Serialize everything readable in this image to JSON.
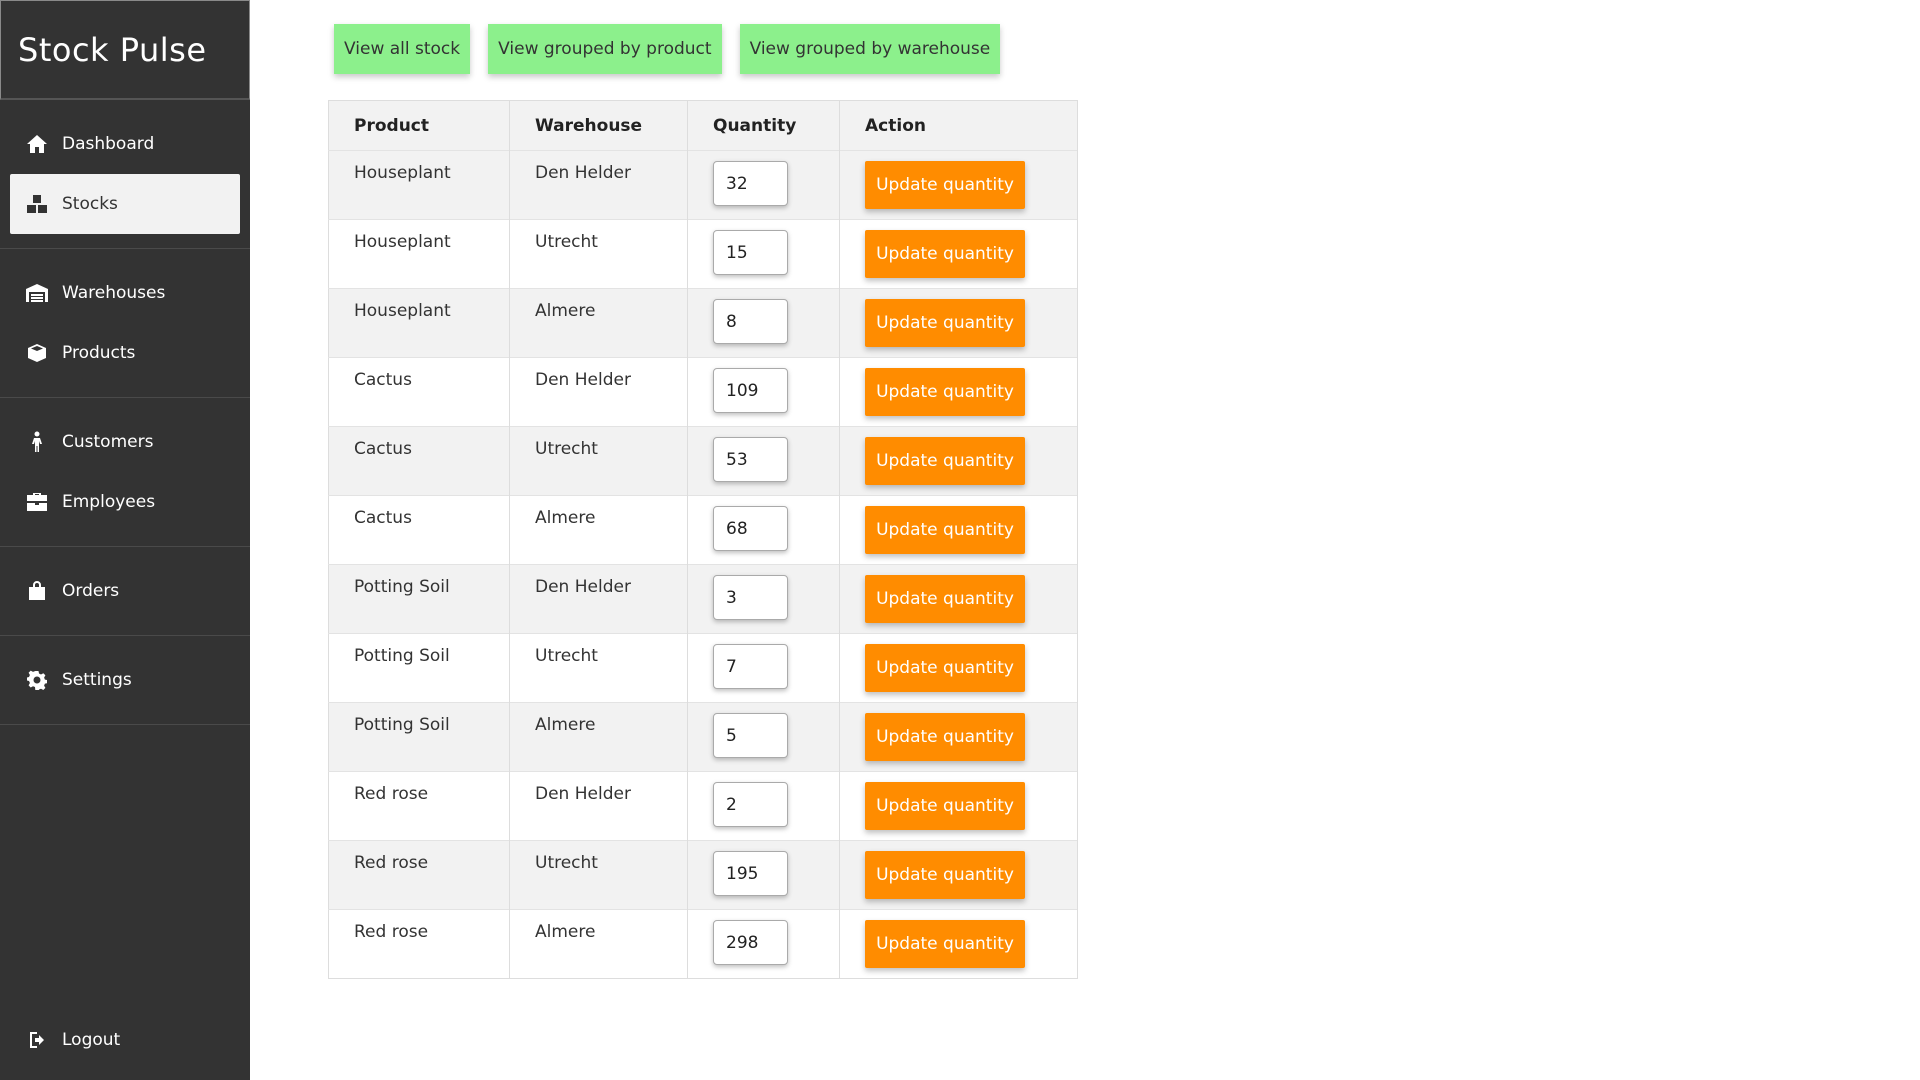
{
  "app": {
    "brand": "Stock Pulse"
  },
  "sidebar": {
    "groups": [
      [
        {
          "label": "Dashboard",
          "icon": "home-icon"
        },
        {
          "label": "Stocks",
          "icon": "boxes-icon",
          "active": true
        }
      ],
      [
        {
          "label": "Warehouses",
          "icon": "warehouse-icon"
        },
        {
          "label": "Products",
          "icon": "box-icon"
        }
      ],
      [
        {
          "label": "Customers",
          "icon": "person-icon"
        },
        {
          "label": "Employees",
          "icon": "briefcase-icon"
        }
      ],
      [
        {
          "label": "Orders",
          "icon": "bag-icon"
        }
      ],
      [
        {
          "label": "Settings",
          "icon": "gear-icon"
        }
      ]
    ],
    "logout": {
      "label": "Logout",
      "icon": "logout-icon"
    }
  },
  "view_buttons": [
    "View all stock",
    "View grouped by product",
    "View grouped by warehouse"
  ],
  "table": {
    "headers": [
      "Product",
      "Warehouse",
      "Quantity",
      "Action"
    ],
    "action_label": "Update quantity",
    "rows": [
      {
        "product": "Houseplant",
        "warehouse": "Den Helder",
        "quantity": "32"
      },
      {
        "product": "Houseplant",
        "warehouse": "Utrecht",
        "quantity": "15"
      },
      {
        "product": "Houseplant",
        "warehouse": "Almere",
        "quantity": "8"
      },
      {
        "product": "Cactus",
        "warehouse": "Den Helder",
        "quantity": "109"
      },
      {
        "product": "Cactus",
        "warehouse": "Utrecht",
        "quantity": "53"
      },
      {
        "product": "Cactus",
        "warehouse": "Almere",
        "quantity": "68"
      },
      {
        "product": "Potting Soil",
        "warehouse": "Den Helder",
        "quantity": "3"
      },
      {
        "product": "Potting Soil",
        "warehouse": "Utrecht",
        "quantity": "7"
      },
      {
        "product": "Potting Soil",
        "warehouse": "Almere",
        "quantity": "5"
      },
      {
        "product": "Red rose",
        "warehouse": "Den Helder",
        "quantity": "2"
      },
      {
        "product": "Red rose",
        "warehouse": "Utrecht",
        "quantity": "195"
      },
      {
        "product": "Red rose",
        "warehouse": "Almere",
        "quantity": "298"
      }
    ]
  },
  "colors": {
    "sidebar": "#333333",
    "view_button": "#8cf08c",
    "action_button": "#ff8c00"
  }
}
